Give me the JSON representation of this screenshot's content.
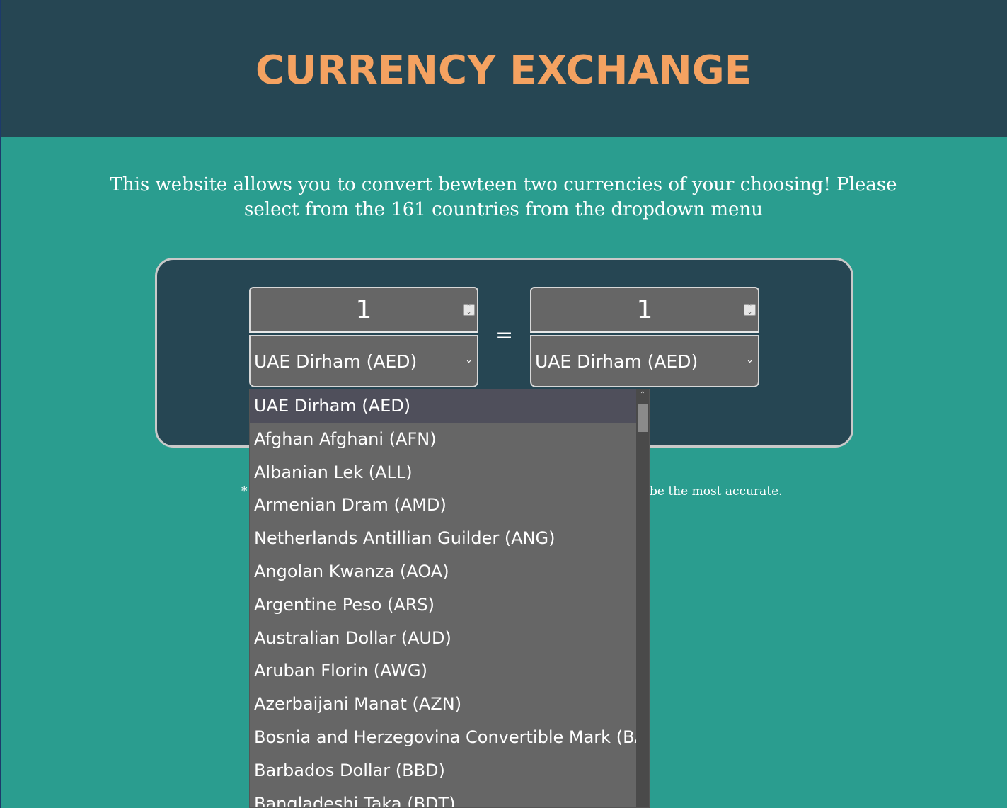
{
  "header": {
    "title": "CURRENCY EXCHANGE"
  },
  "intro": {
    "text": "This website allows you to convert bewteen two currencies of your choosing! Please select from the 161 countries from the dropdown menu"
  },
  "converter": {
    "from": {
      "amount": "1",
      "currency": "UAE Dirham (AED)"
    },
    "to": {
      "amount": "1",
      "currency": "UAE Dirham (AED)"
    },
    "equals": "="
  },
  "note": {
    "prefix": "*",
    "suffix": "be the most accurate."
  },
  "dropdown": {
    "selected": "UAE Dirham (AED)",
    "options": [
      "UAE Dirham (AED)",
      "Afghan Afghani (AFN)",
      "Albanian Lek (ALL)",
      "Armenian Dram (AMD)",
      "Netherlands Antillian Guilder (ANG)",
      "Angolan Kwanza (AOA)",
      "Argentine Peso (ARS)",
      "Australian Dollar (AUD)",
      "Aruban Florin (AWG)",
      "Azerbaijani Manat (AZN)",
      "Bosnia and Herzegovina Convertible Mark (BAM)",
      "Barbados Dollar (BBD)",
      "Bangladeshi Taka (BDT)"
    ]
  }
}
